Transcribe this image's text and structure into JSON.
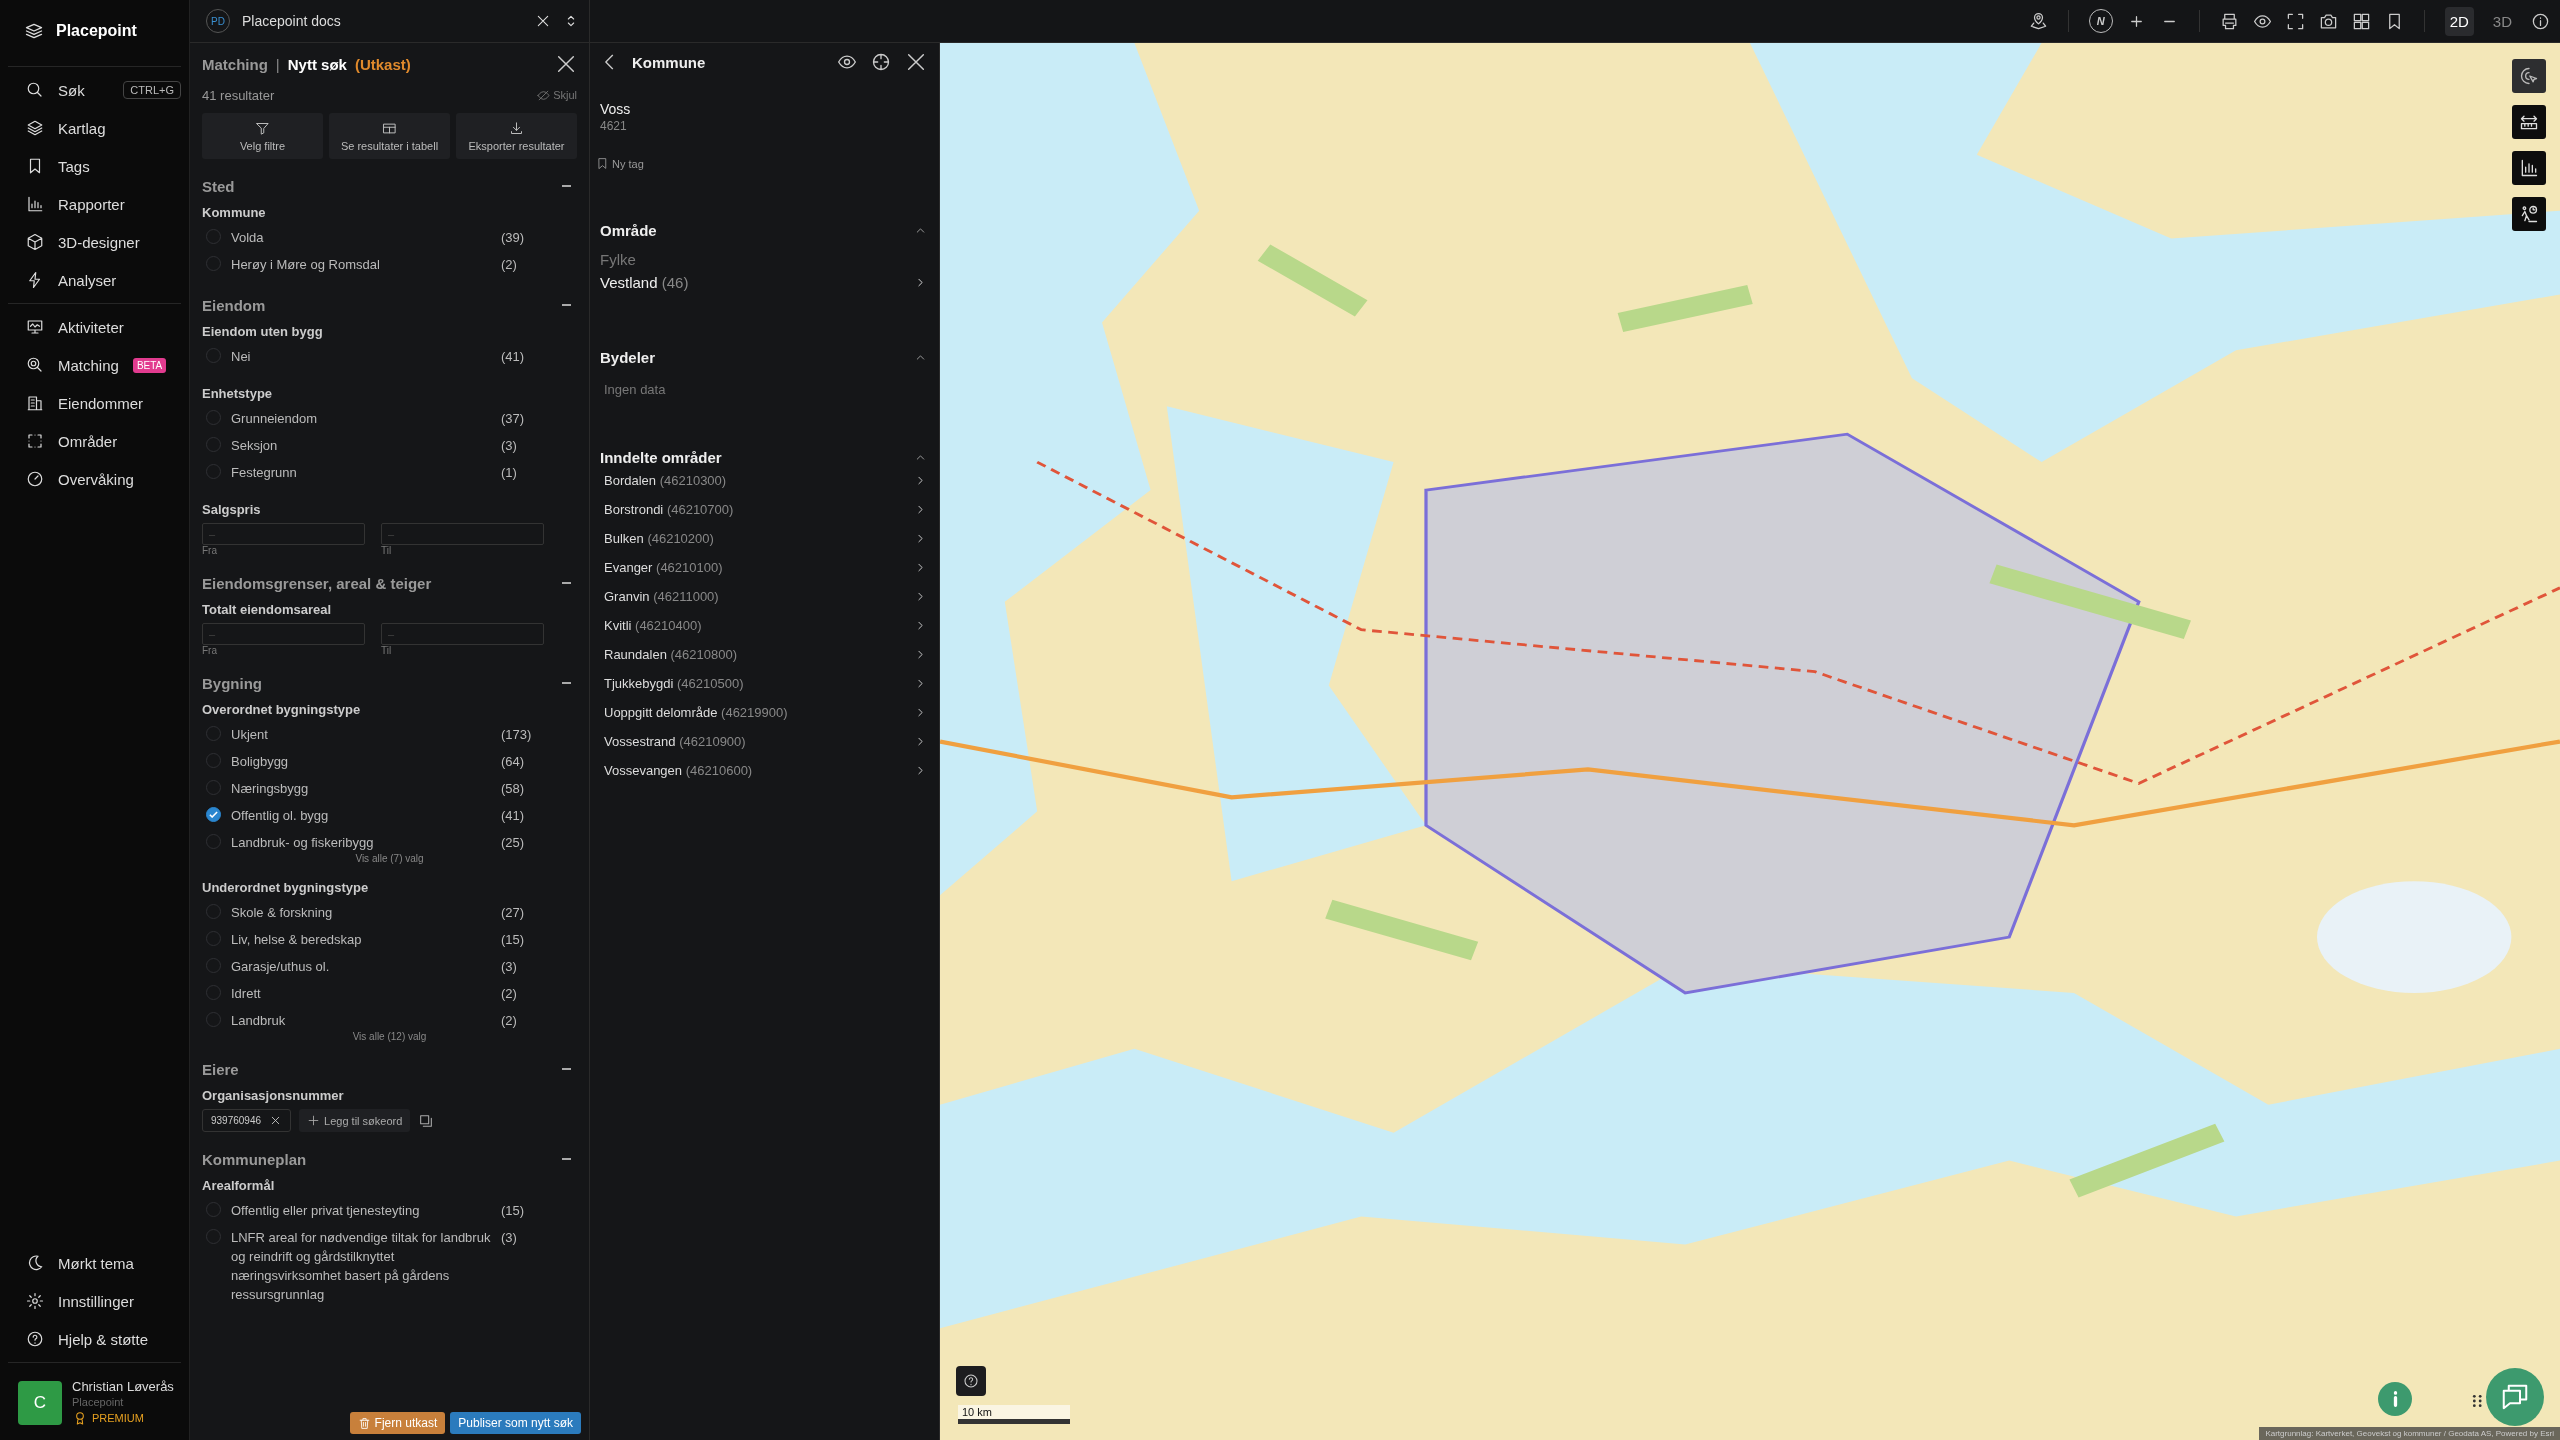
{
  "app": {
    "name": "Placepoint"
  },
  "sidebar": {
    "top_items": [
      {
        "label": "Søk",
        "shortcut": "CTRL+G"
      },
      {
        "label": "Kartlag"
      },
      {
        "label": "Tags"
      },
      {
        "label": "Rapporter"
      },
      {
        "label": "3D-designer"
      },
      {
        "label": "Analyser"
      }
    ],
    "main_items": [
      {
        "label": "Aktiviteter"
      },
      {
        "label": "Matching",
        "badge": "BETA"
      },
      {
        "label": "Eiendommer"
      },
      {
        "label": "Områder"
      },
      {
        "label": "Overvåking"
      }
    ],
    "bottom_items": [
      {
        "label": "Mørkt tema"
      },
      {
        "label": "Innstillinger"
      },
      {
        "label": "Hjelp & støtte"
      }
    ],
    "user": {
      "initial": "C",
      "name": "Christian Løverås",
      "organization": "Placepoint",
      "plan": "PREMIUM"
    }
  },
  "workspace": {
    "initials": "PD",
    "name": "Placepoint docs"
  },
  "search_panel": {
    "breadcrumb": "Matching",
    "separator": "|",
    "title": "Nytt søk",
    "status": "(Utkast)",
    "result_count": "41 resultater",
    "hide_label": "Skjul",
    "actions": [
      {
        "label": "Velg filtre"
      },
      {
        "label": "Se resultater i tabell"
      },
      {
        "label": "Eksporter resultater"
      }
    ],
    "sections": [
      {
        "title": "Sted",
        "expanded": true,
        "groups": [
          {
            "title": "Kommune",
            "kind": "options",
            "options": [
              {
                "label": "Volda",
                "count": "(39)",
                "checked": false
              },
              {
                "label": "Herøy i Møre og Romsdal",
                "count": "(2)",
                "checked": false
              }
            ]
          }
        ]
      },
      {
        "title": "Eiendom",
        "expanded": true,
        "groups": [
          {
            "title": "Eiendom uten bygg",
            "kind": "options",
            "options": [
              {
                "label": "Nei",
                "count": "(41)",
                "checked": false
              }
            ]
          },
          {
            "title": "Enhetstype",
            "kind": "options",
            "options": [
              {
                "label": "Grunneiendom",
                "count": "(37)",
                "checked": false
              },
              {
                "label": "Seksjon",
                "count": "(3)",
                "checked": false
              },
              {
                "label": "Festegrunn",
                "count": "(1)",
                "checked": false
              }
            ]
          },
          {
            "title": "Salgspris",
            "kind": "range",
            "from": {
              "placeholder": "–",
              "label": "Fra"
            },
            "to": {
              "placeholder": "–",
              "label": "Til"
            }
          }
        ]
      },
      {
        "title": "Eiendomsgrenser, areal & teiger",
        "expanded": true,
        "groups": [
          {
            "title": "Totalt eiendomsareal",
            "kind": "range",
            "from": {
              "placeholder": "–",
              "label": "Fra"
            },
            "to": {
              "placeholder": "–",
              "label": "Til"
            }
          }
        ]
      },
      {
        "title": "Bygning",
        "expanded": true,
        "groups": [
          {
            "title": "Overordnet bygningstype",
            "kind": "options",
            "options": [
              {
                "label": "Ukjent",
                "count": "(173)",
                "checked": false
              },
              {
                "label": "Boligbygg",
                "count": "(64)",
                "checked": false
              },
              {
                "label": "Næringsbygg",
                "count": "(58)",
                "checked": false
              },
              {
                "label": "Offentlig ol. bygg",
                "count": "(41)",
                "checked": true
              },
              {
                "label": "Landbruk- og fiskeribygg",
                "count": "(25)",
                "checked": false
              }
            ],
            "show_all": "Vis alle (7) valg"
          },
          {
            "title": "Underordnet bygningstype",
            "kind": "options",
            "options": [
              {
                "label": "Skole & forskning",
                "count": "(27)",
                "checked": false
              },
              {
                "label": "Liv, helse & beredskap",
                "count": "(15)",
                "checked": false
              },
              {
                "label": "Garasje/uthus ol.",
                "count": "(3)",
                "checked": false
              },
              {
                "label": "Idrett",
                "count": "(2)",
                "checked": false
              },
              {
                "label": "Landbruk",
                "count": "(2)",
                "checked": false
              }
            ],
            "show_all": "Vis alle (12) valg"
          }
        ]
      },
      {
        "title": "Eiere",
        "expanded": true,
        "groups": [
          {
            "title": "Organisasjonsnummer",
            "kind": "tags",
            "tags": [
              "939760946"
            ],
            "add_label": "Legg til søkeord"
          }
        ]
      },
      {
        "title": "Kommuneplan",
        "expanded": true,
        "groups": [
          {
            "title": "Arealformål",
            "kind": "options",
            "options": [
              {
                "label": "Offentlig eller privat tjenesteyting",
                "count": "(15)",
                "checked": false
              },
              {
                "label": "LNFR areal for nødvendige tiltak for landbruk og reindrift og gårdstilknyttet næringsvirksomhet basert på gårdens ressursgrunnlag",
                "count": "(3)",
                "checked": false
              }
            ]
          }
        ]
      }
    ],
    "buttons": {
      "discard": "Fjern utkast",
      "publish": "Publiser som nytt søk"
    }
  },
  "detail_panel": {
    "title": "Kommune",
    "name": "Voss",
    "code": "4621",
    "tag_button": "Ny tag",
    "sections": [
      {
        "title": "Område",
        "expanded": true,
        "label": "Fylke",
        "items": [
          {
            "name": "Vestland",
            "code": "(46)"
          }
        ]
      },
      {
        "title": "Bydeler",
        "expanded": true,
        "empty_text": "Ingen data"
      },
      {
        "title": "Inndelte områder",
        "expanded": true,
        "items": [
          {
            "name": "Bordalen",
            "code": "(46210300)"
          },
          {
            "name": "Borstrondi",
            "code": "(46210700)"
          },
          {
            "name": "Bulken",
            "code": "(46210200)"
          },
          {
            "name": "Evanger",
            "code": "(46210100)"
          },
          {
            "name": "Granvin",
            "code": "(46211000)"
          },
          {
            "name": "Kvitli",
            "code": "(46210400)"
          },
          {
            "name": "Raundalen",
            "code": "(46210800)"
          },
          {
            "name": "Tjukkebygdi",
            "code": "(46210500)"
          },
          {
            "name": "Uoppgitt delområde",
            "code": "(46219900)"
          },
          {
            "name": "Vossestrand",
            "code": "(46210900)"
          },
          {
            "name": "Vossevangen",
            "code": "(46210600)"
          }
        ]
      }
    ]
  },
  "map_toolbar": {
    "compass": "N",
    "view_modes": [
      {
        "label": "2D",
        "selected": true
      },
      {
        "label": "3D",
        "selected": false
      }
    ]
  },
  "map_tools": [
    {
      "selected": true
    },
    {
      "selected": false
    },
    {
      "selected": false
    },
    {
      "selected": false
    }
  ],
  "map": {
    "scale": "10 km",
    "attribution": "Kartgrunnlag: Kartverket, Geovekst og kommuner / Geodata AS, Powered by Esri"
  }
}
